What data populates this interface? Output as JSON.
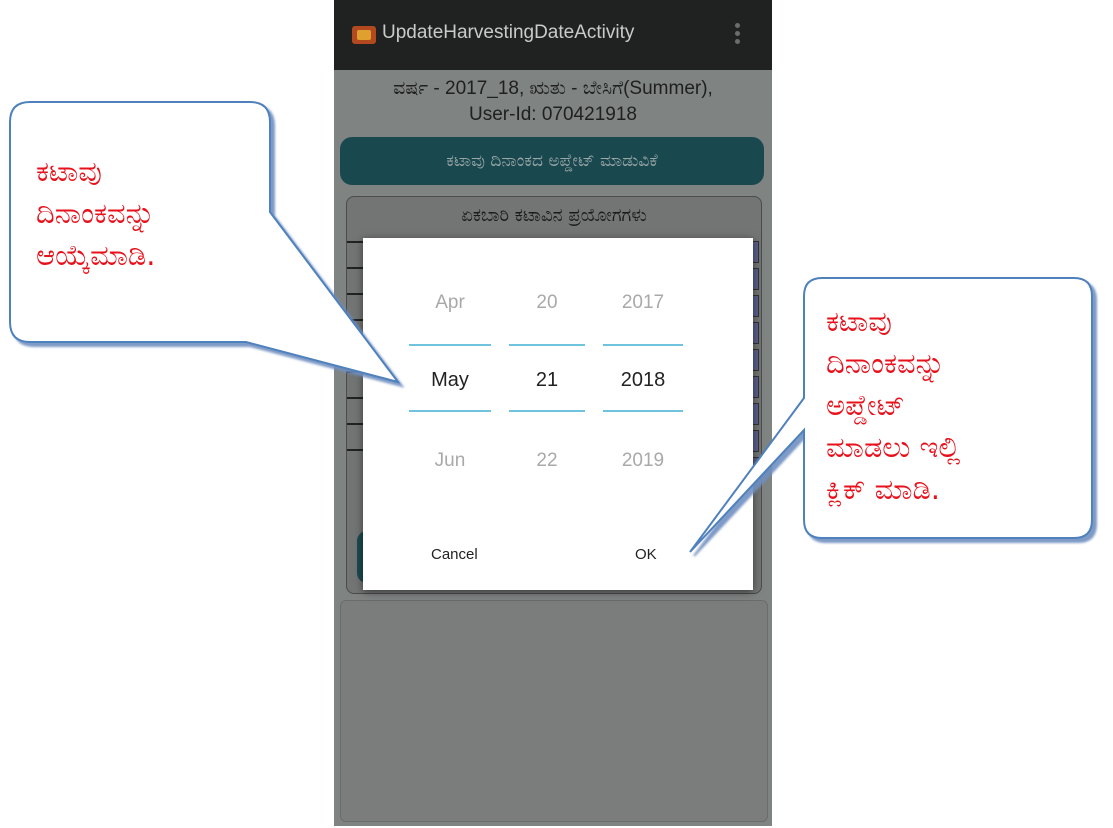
{
  "app": {
    "title": "UpdateHarvestingDateActivity",
    "subtitle_line1": "ವರ್ಷ - 2017_18, ಋತು - ಬೇಸಿಗೆ(Summer),",
    "subtitle_line2": "User-Id: 070421918",
    "update_button_label": "ಕಟಾವು ದಿನಾಂಕದ ಅಪ್ಡೇಟ್ ಮಾಡುವಿಕೆ",
    "card_title": "ಏಕಬಾರಿ ಕಟಾವಿನ ಪ್ರಯೋಗಗಳು"
  },
  "date_picker": {
    "month": {
      "prev": "Apr",
      "current": "May",
      "next": "Jun"
    },
    "day": {
      "prev": "20",
      "current": "21",
      "next": "22"
    },
    "year": {
      "prev": "2017",
      "current": "2018",
      "next": "2019"
    },
    "cancel_label": "Cancel",
    "ok_label": "OK"
  },
  "callouts": {
    "left": {
      "lines": [
        "ಕಟಾವು",
        "ದಿನಾಂಕವನ್ನು",
        "ಆಯ್ಕೆಮಾಡಿ."
      ]
    },
    "right": {
      "lines": [
        "ಕಟಾವು",
        "ದಿನಾಂಕವನ್ನು",
        "ಅಪ್ಡೇಟ್",
        "ಮಾಡಲು ಇಲ್ಲಿ",
        "ಕ್ಲಿಕ್ ಮಾಡಿ."
      ]
    }
  },
  "colors": {
    "callout_text": "#e8101b",
    "callout_border": "#4f81bd",
    "picker_divider": "#6fc3dc",
    "teal_button": "#19484f"
  },
  "icons": {
    "app_icon": "app-logo-icon",
    "overflow": "overflow-menu-icon"
  }
}
